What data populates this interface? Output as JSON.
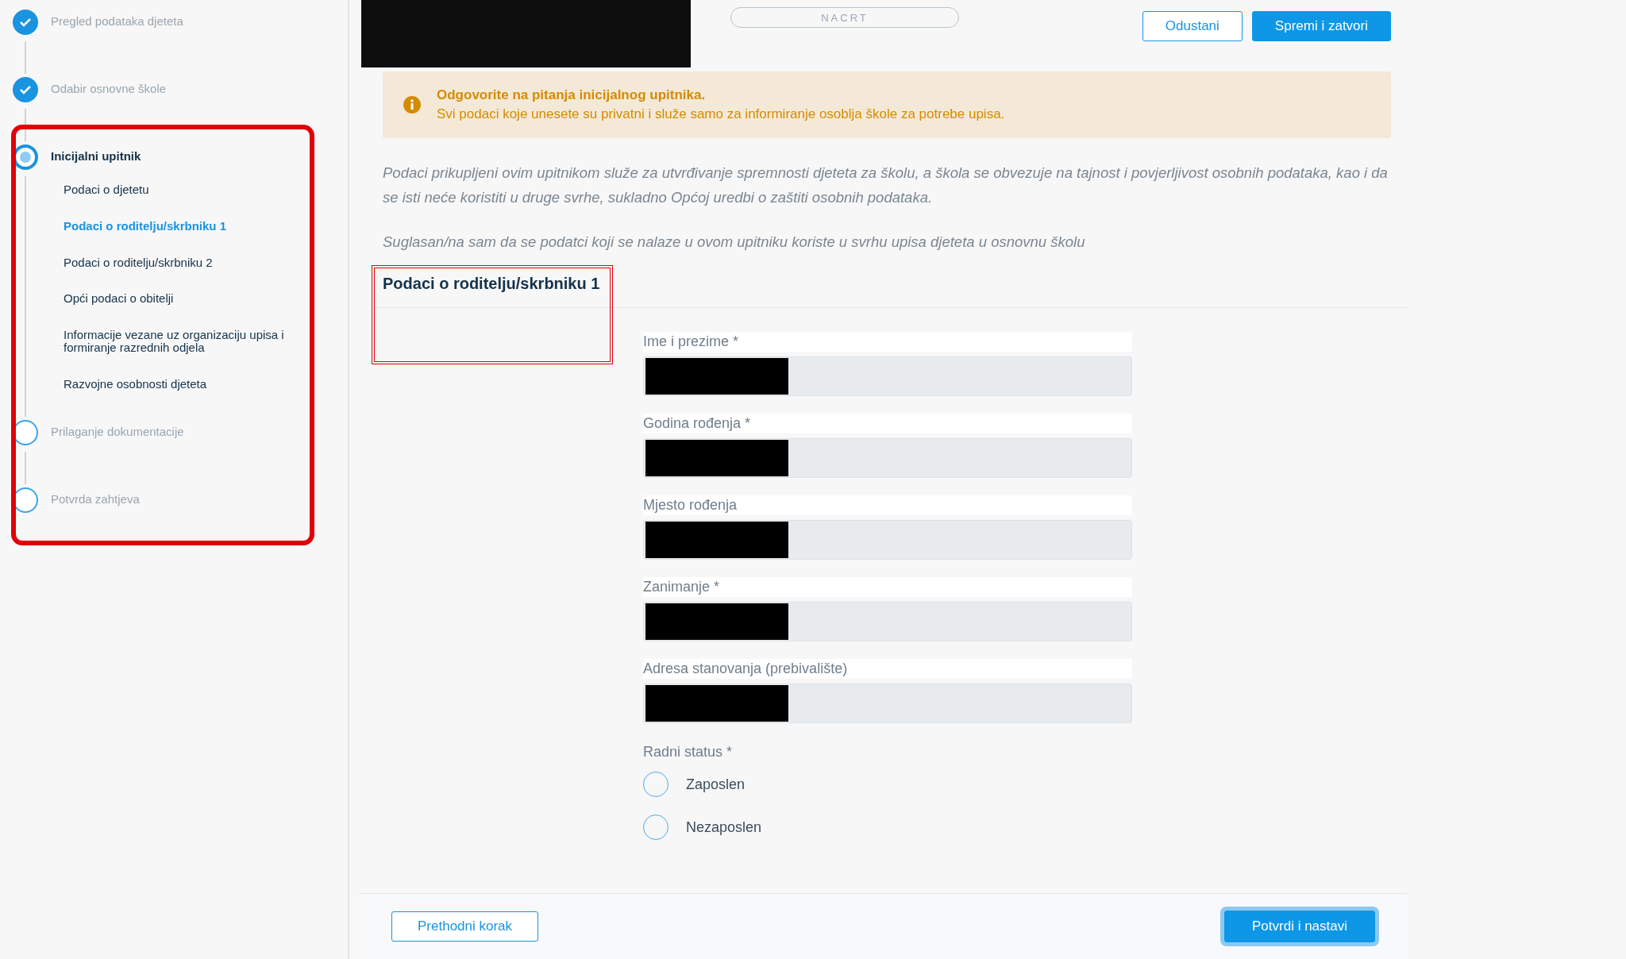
{
  "sidebar": {
    "steps": [
      {
        "label": "Pregled podataka djeteta",
        "completed": true,
        "current": false
      },
      {
        "label": "Odabir osnovne škole",
        "completed": true,
        "current": false
      },
      {
        "label": "Inicijalni upitnik",
        "completed": false,
        "current": true,
        "children": [
          {
            "label": "Podaci o djetetu",
            "selected": false
          },
          {
            "label": "Podaci o roditelju/skrbniku 1",
            "selected": true
          },
          {
            "label": "Podaci o roditelju/skrbniku 2",
            "selected": false
          },
          {
            "label": "Opći podaci o obitelji",
            "selected": false
          },
          {
            "label": "Informacije vezane uz organizaciju upisa i formiranje razrednih odjela",
            "selected": false
          },
          {
            "label": "Razvojne osobnosti djeteta",
            "selected": false
          }
        ]
      },
      {
        "label": "Prilaganje dokumentacije",
        "completed": false,
        "current": false
      },
      {
        "label": "Potvrda zahtjeva",
        "completed": false,
        "current": false
      }
    ]
  },
  "status_badge": "NACRT",
  "header_buttons": [
    {
      "label": "Odustani",
      "kind": "secondary"
    },
    {
      "label": "Spremi i zatvori",
      "kind": "primary"
    }
  ],
  "alert": {
    "title": "Odgovorite na pitanja inicijalnog upitnika.",
    "text": "Svi podaci koje unesete su privatni i služe samo za informiranje osoblja škole za potrebe upisa."
  },
  "intro": "Podaci prikupljeni ovim upitnikom služe za utvrđivanje spremnosti djeteta za školu, a škola se obvezuje na tajnost i povjerljivost osobnih podataka, kao i da se isti neće koristiti u druge svrhe, sukladno Općoj uredbi o zaštiti osobnih podataka.",
  "consent": "Suglasan/na sam da se podatci koji se nalaze u ovom upitniku koriste u svrhu upisa djeteta u osnovnu školu",
  "section_title": "Podaci o roditelju/skrbniku 1",
  "fields": [
    {
      "label": "Ime i prezime *"
    },
    {
      "label": "Godina rođenja *"
    },
    {
      "label": "Mjesto rođenja"
    },
    {
      "label": "Zanimanje *"
    },
    {
      "label": "Adresa stanovanja (prebivalište)"
    }
  ],
  "radio_group": {
    "label": "Radni status *",
    "options": [
      {
        "label": "Zaposlen",
        "selected": false
      },
      {
        "label": "Nezaposlen",
        "selected": false
      }
    ]
  },
  "footer_buttons": [
    {
      "label": "Prethodni korak",
      "kind": "secondary"
    },
    {
      "label": "Potvrdi i nastavi",
      "kind": "primary"
    }
  ]
}
